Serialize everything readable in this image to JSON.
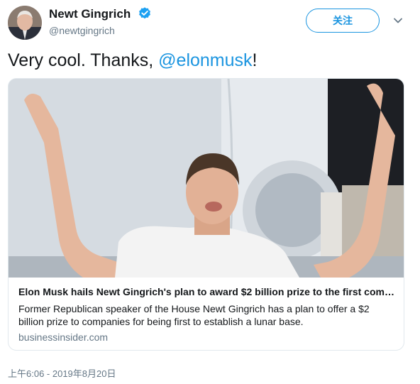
{
  "author": {
    "display_name": "Newt Gingrich",
    "handle": "@newtgingrich",
    "verified": true
  },
  "follow_button": {
    "label": "关注"
  },
  "tweet": {
    "text_before": "Very cool. Thanks, ",
    "mention": "@elonmusk",
    "text_after": "!"
  },
  "card": {
    "title": "Elon Musk hails Newt Gingrich's plan to award $2 billion prize to the first com…",
    "description": "Former Republican speaker of the House Newt Gingrich has a plan to offer a $2 billion prize to companies for being first to establish a lunar base.",
    "domain": "businessinsider.com"
  },
  "timestamp": "上午6:06 - 2019年8月20日",
  "icons": {
    "verified": "verified-badge-icon",
    "more": "chevron-down-icon"
  },
  "colors": {
    "accent": "#1b95e0",
    "secondary_text": "#657786",
    "primary_text": "#14171a",
    "card_border": "#e1e8ed"
  }
}
